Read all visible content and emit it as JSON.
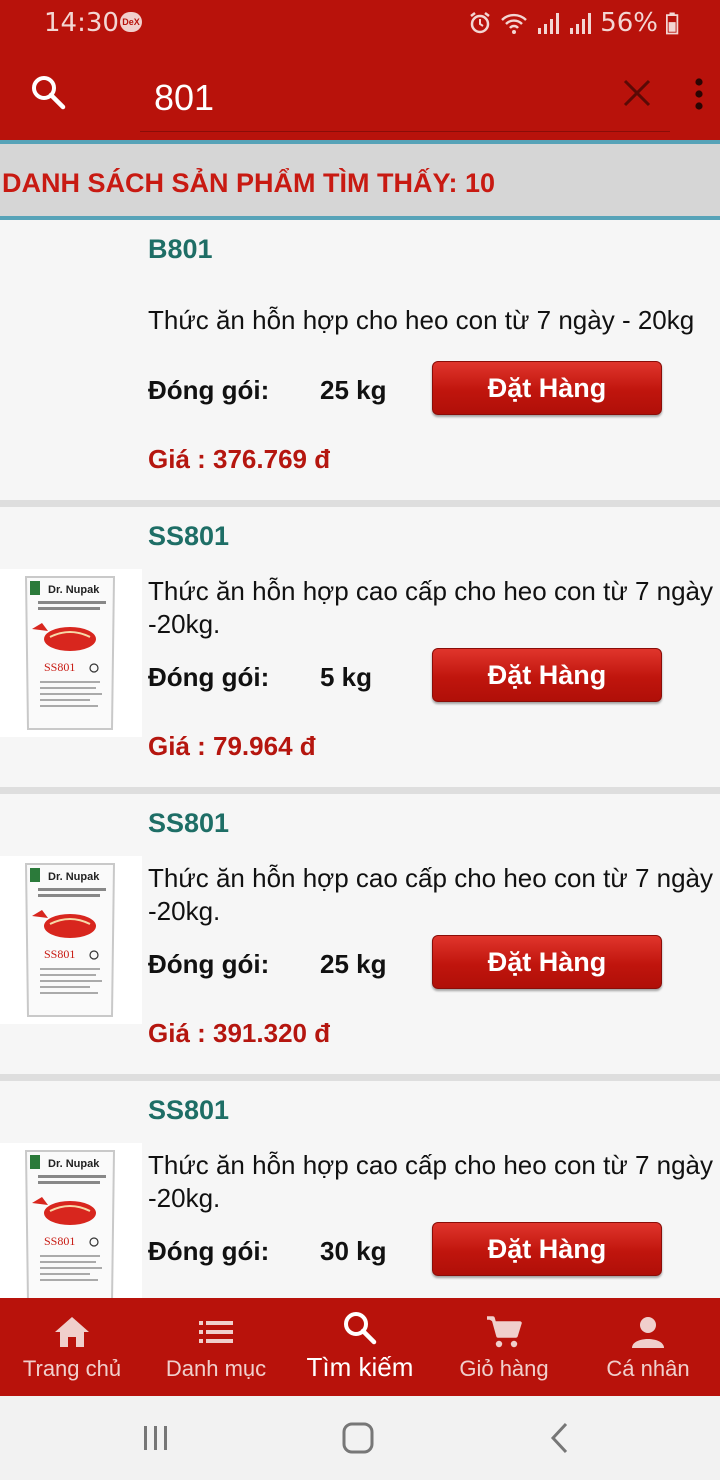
{
  "status_bar": {
    "time": "14:30",
    "dex_badge": "DeX",
    "battery": "56%",
    "icons": [
      "alarm-icon",
      "wifi-icon",
      "signal-icon",
      "signal-icon",
      "battery-icon"
    ]
  },
  "search": {
    "value": "801",
    "placeholder": ""
  },
  "results": {
    "label": "DANH SÁCH SẢN PHẨM TÌM THẤY:  10"
  },
  "labels": {
    "pack": "Đóng gói:",
    "order_button": "Đặt Hàng"
  },
  "products": [
    {
      "code": "B801",
      "name": "Thức ăn hỗn hợp cho heo con từ 7 ngày - 20kg",
      "pack_size": "25 kg",
      "price": "Giá : 376.769 đ",
      "has_image": false
    },
    {
      "code": "SS801",
      "name": "Thức ăn hỗn hợp cao cấp cho heo con từ 7 ngày -20kg.",
      "pack_size": "5 kg",
      "price": "Giá : 79.964 đ",
      "has_image": true
    },
    {
      "code": "SS801",
      "name": "Thức ăn hỗn hợp cao cấp cho heo con từ 7 ngày -20kg.",
      "pack_size": "25 kg",
      "price": "Giá : 391.320 đ",
      "has_image": true
    },
    {
      "code": "SS801",
      "name": "Thức ăn hỗn hợp cao cấp cho heo con từ 7 ngày -20kg.",
      "pack_size": "30 kg",
      "price": "",
      "has_image": true
    }
  ],
  "product_image": {
    "brand": "Dr. Nupak",
    "product_code": "SS801"
  },
  "bottom_nav": [
    {
      "label": "Trang chủ",
      "icon": "home-icon",
      "active": false
    },
    {
      "label": "Danh mục",
      "icon": "list-icon",
      "active": false
    },
    {
      "label": "Tìm kiếm",
      "icon": "search-icon",
      "active": true
    },
    {
      "label": "Giỏ hàng",
      "icon": "cart-icon",
      "active": false
    },
    {
      "label": "Cá nhân",
      "icon": "person-icon",
      "active": false
    }
  ],
  "colors": {
    "primary": "#b8120b",
    "accent_teal": "#1e6e66",
    "price_red": "#b5160f",
    "header_border": "#57a3b8"
  }
}
